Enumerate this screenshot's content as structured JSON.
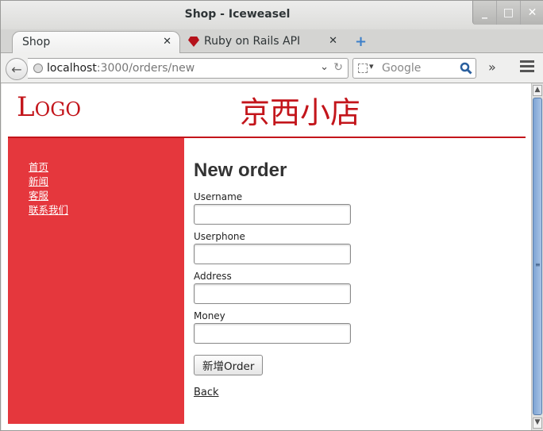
{
  "window": {
    "title": "Shop - Iceweasel"
  },
  "tabs": [
    {
      "label": "Shop"
    },
    {
      "label": "Ruby on Rails API"
    }
  ],
  "navbar": {
    "url_host": "localhost",
    "url_rest": ":3000/orders/new",
    "search_placeholder": "Google"
  },
  "page": {
    "logo": "Logo",
    "shop_name": "京西小店",
    "accent_color": "#c3151b",
    "sidebar_color": "#e5373d",
    "sidebar": {
      "items": [
        {
          "label": "首页"
        },
        {
          "label": "新闻"
        },
        {
          "label": "客服"
        },
        {
          "label": "联系我们"
        }
      ]
    },
    "heading": "New order",
    "fields": [
      {
        "label": "Username",
        "value": ""
      },
      {
        "label": "Userphone",
        "value": ""
      },
      {
        "label": "Address",
        "value": ""
      },
      {
        "label": "Money",
        "value": ""
      }
    ],
    "submit_label": "新增Order",
    "back_label": "Back"
  }
}
